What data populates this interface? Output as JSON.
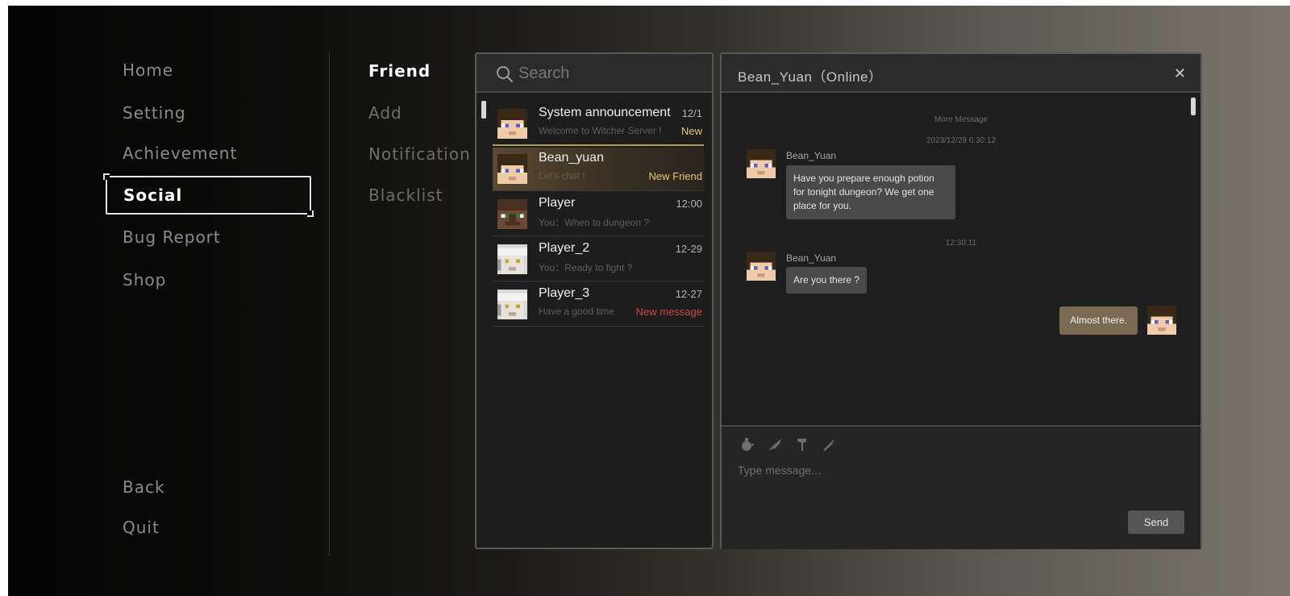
{
  "main_menu": {
    "items": [
      {
        "label": "Home"
      },
      {
        "label": "Setting"
      },
      {
        "label": "Achievement"
      },
      {
        "label": "Social"
      },
      {
        "label": "Bug Report"
      },
      {
        "label": "Shop"
      }
    ],
    "active": "Social",
    "back_label": "Back",
    "quit_label": "Quit"
  },
  "sub_menu": {
    "items": [
      {
        "label": "Friend"
      },
      {
        "label": "Add"
      },
      {
        "label": "Notification"
      },
      {
        "label": "Blacklist"
      }
    ],
    "active": "Friend"
  },
  "search": {
    "placeholder": "Search"
  },
  "friends": [
    {
      "name": "System announcement",
      "time": "12/1",
      "message": "Welcome to  Witcher Server !",
      "badge": "New",
      "badge_color": "#e8c77a",
      "avatar": "steve-avatar"
    },
    {
      "name": "Bean_yuan",
      "time": "",
      "message": "Let's chat !",
      "badge": "New Friend",
      "badge_color": "#e8c77a",
      "avatar": "steve-avatar",
      "selected": true
    },
    {
      "name": "Player",
      "time": "12:00",
      "message": "You：When to dungeon ?",
      "badge": "",
      "avatar": "villager-avatar"
    },
    {
      "name": "Player_2",
      "time": "12-29",
      "message": "You：Ready to fight ?",
      "badge": "",
      "avatar": "white-hair-avatar"
    },
    {
      "name": "Player_3",
      "time": "12-27",
      "message": "Have a good time",
      "badge": "New message",
      "badge_color": "#d0473d",
      "avatar": "white-hair-avatar"
    }
  ],
  "chat": {
    "title": "Bean_Yuan（Online）",
    "close_glyph": "✕",
    "more_message": "More Message",
    "messages": [
      {
        "timestamp": "2023/12/29 6:30:12",
        "sender": "Bean_Yuan",
        "text_lines": [
          "Have you prepare enough potion",
          "for tonight dungeon? We get one",
          "place for you."
        ],
        "mine": false
      },
      {
        "timestamp": "12:30:11",
        "sender": "Bean_Yuan",
        "text_lines": [
          "Are you there ?"
        ],
        "mine": false
      },
      {
        "timestamp": "",
        "sender": "",
        "text_lines": [
          "Almost there."
        ],
        "mine": true
      }
    ],
    "toolbar_icons": [
      "potion-icon",
      "feather-icon",
      "axe-icon",
      "carrot-icon"
    ],
    "input_placeholder": "Type message...",
    "send_label": "Send"
  },
  "colors": {
    "accent_gold": "#e8c77a",
    "alert_red": "#d0473d",
    "my_bubble": "#7a6a52",
    "their_bubble": "#4a4a4a"
  }
}
